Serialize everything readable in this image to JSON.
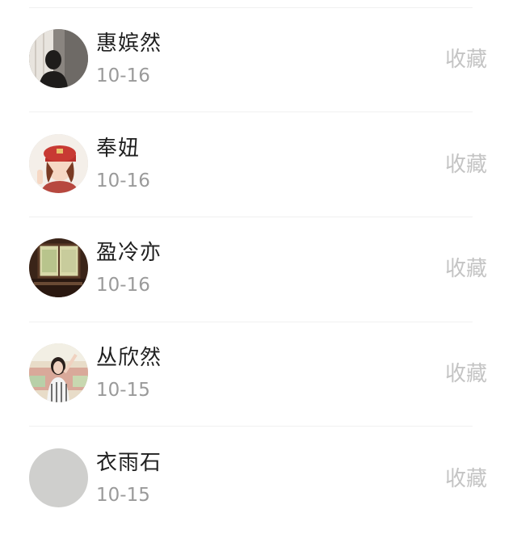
{
  "contacts": [
    {
      "name": "惠嫔然",
      "date": "10-16",
      "action": "收藏",
      "avatar": "silhouette-portrait"
    },
    {
      "name": "奉妞",
      "date": "10-16",
      "action": "收藏",
      "avatar": "cartoon-girl-red-cap"
    },
    {
      "name": "盈冷亦",
      "date": "10-16",
      "action": "收藏",
      "avatar": "window-scene"
    },
    {
      "name": "丛欣然",
      "date": "10-15",
      "action": "收藏",
      "avatar": "girl-photo"
    },
    {
      "name": "衣雨石",
      "date": "10-15",
      "action": "收藏",
      "avatar": "placeholder-gray"
    }
  ]
}
